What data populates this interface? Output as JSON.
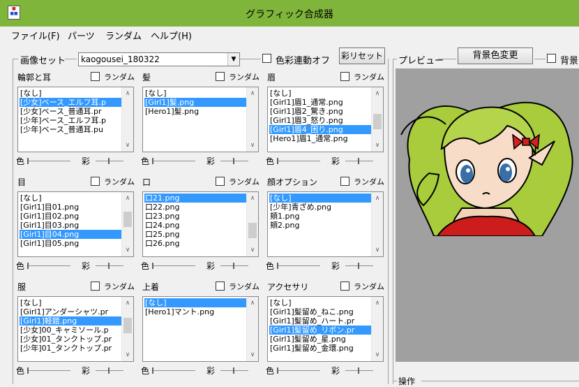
{
  "window": {
    "title": "グラフィック合成器",
    "icon": "app-icon"
  },
  "menu": [
    "ファイル(F)",
    "パーツ",
    "ランダム",
    "ヘルプ(H)"
  ],
  "image_set": {
    "label": "画像セット",
    "combo_value": "kaogousei_180322",
    "color_link_label": "色彩連動オフ",
    "reset_button": "彩リセット"
  },
  "preview": {
    "label": "プレビュー",
    "bg_button": "背景色変更",
    "bg_check_label": "背景"
  },
  "operation_label": "操作",
  "common": {
    "random": "ランダム",
    "color": "色",
    "saturation": "彩"
  },
  "panels": [
    {
      "id": "rinkaku",
      "title": "輪郭と耳",
      "items": [
        "[なし]",
        "[少女]ベース_エルフ耳.p",
        "[少女]ベース_普通耳.pr",
        "[少年]ベース_エルフ耳.p",
        "[少年]ベース_普通耳.pu"
      ],
      "selected": 1
    },
    {
      "id": "kami",
      "title": "髪",
      "items": [
        "[なし]",
        "[Girl1]髪.png",
        "[Hero1]髪.png"
      ],
      "selected": 1
    },
    {
      "id": "mayu",
      "title": "眉",
      "items": [
        "[なし]",
        "[Girl1]眉1_通常.png",
        "[Girl1]眉2_驚き.png",
        "[Girl1]眉3_怒り.png",
        "[Girl1]眉4_困り.png",
        "[Hero1]眉1_通常.png"
      ],
      "selected": 4
    },
    {
      "id": "me",
      "title": "目",
      "items": [
        "[なし]",
        "[Girl1]目01.png",
        "[Girl1]目02.png",
        "[Girl1]目03.png",
        "[Girl1]目04.png",
        "[Girl1]目05.png"
      ],
      "selected": 4
    },
    {
      "id": "kuchi",
      "title": "口",
      "items": [
        "口21.png",
        "口22.png",
        "口23.png",
        "口24.png",
        "口25.png",
        "口26.png"
      ],
      "selected": 0
    },
    {
      "id": "kao-option",
      "title": "顔オプション",
      "items": [
        "[なし]",
        "[少年]青ざめ.png",
        "頬1.png",
        "頬2.png"
      ],
      "selected": 0
    },
    {
      "id": "fuku",
      "title": "服",
      "items": [
        "[なし]",
        "[Girl1]アンダーシャツ.pr",
        "[Girl1]軽鎧.png",
        "[少女]00_キャミソール.p",
        "[少女]01_タンクトップ.pr",
        "[少年]01_タンクトップ.pr"
      ],
      "selected": 2
    },
    {
      "id": "uwagi",
      "title": "上着",
      "items": [
        "[なし]",
        "[Hero1]マント.png"
      ],
      "selected": 0
    },
    {
      "id": "accessory",
      "title": "アクセサリ",
      "items": [
        "[なし]",
        "[Girl1]髪留め_ねこ.png",
        "[Girl1]髪留め_ハート.pr",
        "[Girl1]髪留め_リボン.pr",
        "[Girl1]髪留め_星.png",
        "[Girl1]髪留め_金環.png"
      ],
      "selected": 3
    }
  ],
  "colors": {
    "titlebar": "#7fb53a",
    "selection": "#3399ff",
    "preview_bg": "#a0a0a0",
    "hair": "#a8cc3c",
    "ribbon": "#d42020",
    "eye": "#3a6ea8"
  }
}
